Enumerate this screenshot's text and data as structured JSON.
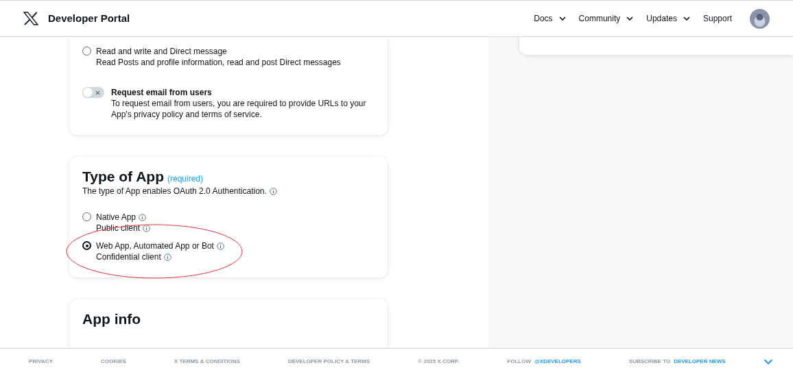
{
  "header": {
    "title": "Developer Portal",
    "nav": [
      {
        "label": "Docs",
        "dropdown": true
      },
      {
        "label": "Community",
        "dropdown": true
      },
      {
        "label": "Updates",
        "dropdown": true
      },
      {
        "label": "Support",
        "dropdown": false
      }
    ]
  },
  "permissions": {
    "options": [
      {
        "label": "Read and write and Direct message",
        "description": "Read Posts and profile information, read and post Direct messages",
        "selected": false
      }
    ],
    "toggle": {
      "label": "Request email from users",
      "description": "To request email from users, you are required to provide URLs to your App's privacy policy and terms of service.",
      "on": false
    }
  },
  "type_of_app": {
    "title": "Type of App",
    "required": "(required)",
    "description": "The type of App enables OAuth 2.0 Authentication.",
    "options": [
      {
        "label": "Native App",
        "description": "Public client",
        "selected": false
      },
      {
        "label": "Web App, Automated App or Bot",
        "description": "Confidential client",
        "selected": true
      }
    ]
  },
  "app_info": {
    "title": "App info"
  },
  "footer": {
    "links": [
      "PRIVACY",
      "COOKIES",
      "X TERMS & CONDITIONS",
      "DEVELOPER POLICY & TERMS",
      "© 2025 X CORP."
    ],
    "follow": {
      "prefix": "FOLLOW",
      "link": "@XDEVELOPERS"
    },
    "subscribe": {
      "prefix": "SUBSCRIBE TO",
      "link": "DEVELOPER NEWS"
    }
  }
}
